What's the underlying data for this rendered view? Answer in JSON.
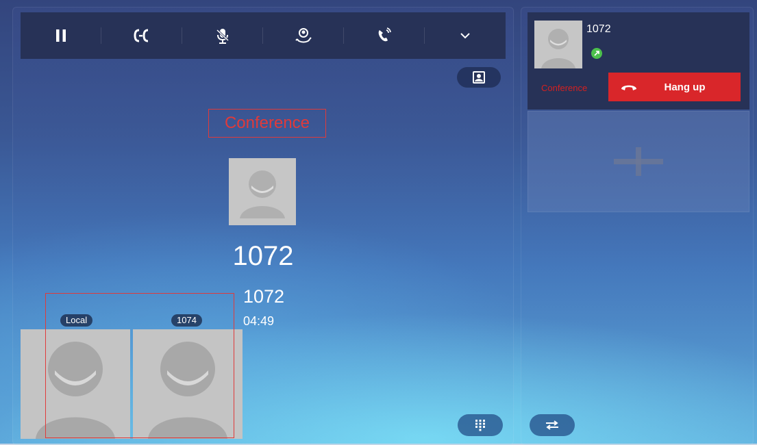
{
  "toolbar": {
    "buttons": [
      {
        "name": "hold-button",
        "icon": "pause-icon"
      },
      {
        "name": "transfer-button",
        "icon": "call-transfer-icon"
      },
      {
        "name": "mute-button",
        "icon": "mute-mic-icon"
      },
      {
        "name": "conference-button",
        "icon": "add-participant-icon"
      },
      {
        "name": "volume-button",
        "icon": "speaker-phone-icon"
      },
      {
        "name": "more-button",
        "icon": "chevron-down-icon"
      }
    ]
  },
  "call": {
    "mode_label": "Conference",
    "display_name": "1072",
    "number": "1072",
    "duration": "04:49"
  },
  "video": {
    "local_label": "Local",
    "remote_label": "1074"
  },
  "sidebar": {
    "active_call": {
      "name": "1072",
      "status_color": "#4cc04c",
      "mode_label": "Conference",
      "hangup_label": "Hang up"
    }
  },
  "colors": {
    "accent_red": "#d9262a",
    "toolbar_bg": "#273257"
  }
}
